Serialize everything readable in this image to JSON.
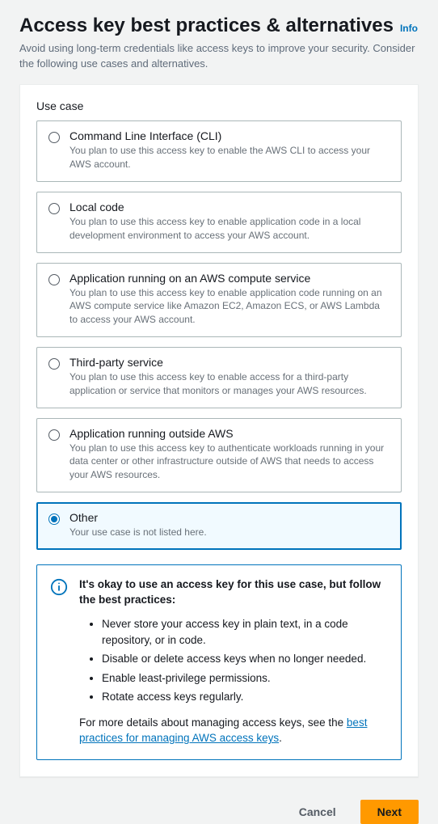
{
  "header": {
    "title": "Access key best practices & alternatives",
    "info_label": "Info",
    "subtitle": "Avoid using long-term credentials like access keys to improve your security. Consider the following use cases and alternatives."
  },
  "section_label": "Use case",
  "options": [
    {
      "id": "cli",
      "title": "Command Line Interface (CLI)",
      "desc": "You plan to use this access key to enable the AWS CLI to access your AWS account.",
      "selected": false
    },
    {
      "id": "local-code",
      "title": "Local code",
      "desc": "You plan to use this access key to enable application code in a local development environment to access your AWS account.",
      "selected": false
    },
    {
      "id": "compute-service",
      "title": "Application running on an AWS compute service",
      "desc": "You plan to use this access key to enable application code running on an AWS compute service like Amazon EC2, Amazon ECS, or AWS Lambda to access your AWS account.",
      "selected": false
    },
    {
      "id": "third-party",
      "title": "Third-party service",
      "desc": "You plan to use this access key to enable access for a third-party application or service that monitors or manages your AWS resources.",
      "selected": false
    },
    {
      "id": "outside-aws",
      "title": "Application running outside AWS",
      "desc": "You plan to use this access key to authenticate workloads running in your data center or other infrastructure outside of AWS that needs to access your AWS resources.",
      "selected": false
    },
    {
      "id": "other",
      "title": "Other",
      "desc": "Your use case is not listed here.",
      "selected": true
    }
  ],
  "alert": {
    "title": "It's okay to use an access key for this use case, but follow the best practices:",
    "bullets": [
      "Never store your access key in plain text, in a code repository, or in code.",
      "Disable or delete access keys when no longer needed.",
      "Enable least-privilege permissions.",
      "Rotate access keys regularly."
    ],
    "footer_prefix": "For more details about managing access keys, see the ",
    "footer_link": "best practices for managing AWS access keys",
    "footer_suffix": "."
  },
  "buttons": {
    "cancel": "Cancel",
    "next": "Next"
  }
}
